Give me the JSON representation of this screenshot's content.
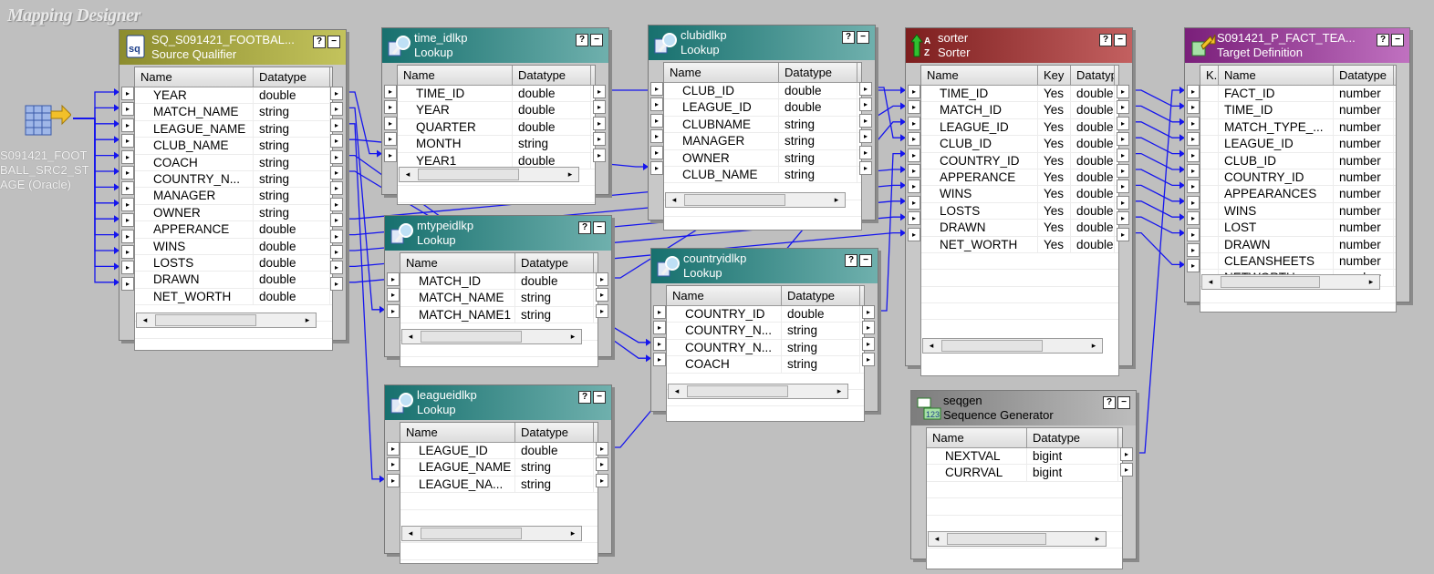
{
  "canvas": {
    "title": "Mapping Designer"
  },
  "source": {
    "label": "S091421_FOOTBALL_SRC2_STAGE (Oracle)",
    "label_lines": [
      "S091421_FOOT",
      "BALL_SRC2_ST",
      "AGE (Oracle)"
    ]
  },
  "colors": {
    "link": "#1515ee",
    "source_qualifier": "#a6a646",
    "lookup": "#3a8f8c",
    "sorter": "#a03a3a",
    "target": "#9c469c",
    "sequence": "#9e9e9e"
  },
  "transforms": {
    "sq": {
      "name": "SQ_S091421_FOOTBAL...",
      "type": "Source Qualifier",
      "icon": "sq-icon",
      "columns": [
        "Name",
        "Datatype"
      ],
      "rows": [
        {
          "name": "YEAR",
          "datatype": "double"
        },
        {
          "name": "MATCH_NAME",
          "datatype": "string"
        },
        {
          "name": "LEAGUE_NAME",
          "datatype": "string"
        },
        {
          "name": "CLUB_NAME",
          "datatype": "string"
        },
        {
          "name": "COACH",
          "datatype": "string"
        },
        {
          "name": "COUNTRY_N...",
          "datatype": "string"
        },
        {
          "name": "MANAGER",
          "datatype": "string"
        },
        {
          "name": "OWNER",
          "datatype": "string"
        },
        {
          "name": "APPERANCE",
          "datatype": "double"
        },
        {
          "name": "WINS",
          "datatype": "double"
        },
        {
          "name": "LOSTS",
          "datatype": "double"
        },
        {
          "name": "DRAWN",
          "datatype": "double"
        },
        {
          "name": "NET_WORTH",
          "datatype": "double"
        }
      ]
    },
    "time": {
      "name": "time_idlkp",
      "type": "Lookup",
      "icon": "lookup-icon",
      "columns": [
        "Name",
        "Datatype"
      ],
      "rows": [
        {
          "name": "TIME_ID",
          "datatype": "double"
        },
        {
          "name": "YEAR",
          "datatype": "double"
        },
        {
          "name": "QUARTER",
          "datatype": "double"
        },
        {
          "name": "MONTH",
          "datatype": "string"
        },
        {
          "name": "YEAR1",
          "datatype": "double"
        }
      ]
    },
    "mtype": {
      "name": "mtypeidlkp",
      "type": "Lookup",
      "icon": "lookup-icon",
      "columns": [
        "Name",
        "Datatype"
      ],
      "rows": [
        {
          "name": "MATCH_ID",
          "datatype": "double"
        },
        {
          "name": "MATCH_NAME",
          "datatype": "string"
        },
        {
          "name": "MATCH_NAME1",
          "datatype": "string"
        }
      ]
    },
    "league": {
      "name": "leagueidlkp",
      "type": "Lookup",
      "icon": "lookup-icon",
      "columns": [
        "Name",
        "Datatype"
      ],
      "rows": [
        {
          "name": "LEAGUE_ID",
          "datatype": "double"
        },
        {
          "name": "LEAGUE_NAME",
          "datatype": "string"
        },
        {
          "name": "LEAGUE_NA...",
          "datatype": "string"
        }
      ]
    },
    "club": {
      "name": "clubidlkp",
      "type": "Lookup",
      "icon": "lookup-icon",
      "columns": [
        "Name",
        "Datatype"
      ],
      "rows": [
        {
          "name": "CLUB_ID",
          "datatype": "double"
        },
        {
          "name": "LEAGUE_ID",
          "datatype": "double"
        },
        {
          "name": "CLUBNAME",
          "datatype": "string"
        },
        {
          "name": "MANAGER",
          "datatype": "string"
        },
        {
          "name": "OWNER",
          "datatype": "string"
        },
        {
          "name": "CLUB_NAME",
          "datatype": "string"
        }
      ]
    },
    "country": {
      "name": "countryidlkp",
      "type": "Lookup",
      "icon": "lookup-icon",
      "columns": [
        "Name",
        "Datatype"
      ],
      "rows": [
        {
          "name": "COUNTRY_ID",
          "datatype": "double"
        },
        {
          "name": "COUNTRY_N...",
          "datatype": "string"
        },
        {
          "name": "COUNTRY_N...",
          "datatype": "string"
        },
        {
          "name": "COACH",
          "datatype": "string"
        }
      ]
    },
    "sorter": {
      "name": "sorter",
      "type": "Sorter",
      "icon": "sorter-icon",
      "columns": [
        "Name",
        "Key",
        "Datatype"
      ],
      "rows": [
        {
          "name": "TIME_ID",
          "key": "Yes",
          "datatype": "double"
        },
        {
          "name": "MATCH_ID",
          "key": "Yes",
          "datatype": "double"
        },
        {
          "name": "LEAGUE_ID",
          "key": "Yes",
          "datatype": "double"
        },
        {
          "name": "CLUB_ID",
          "key": "Yes",
          "datatype": "double"
        },
        {
          "name": "COUNTRY_ID",
          "key": "Yes",
          "datatype": "double"
        },
        {
          "name": "APPERANCE",
          "key": "Yes",
          "datatype": "double"
        },
        {
          "name": "WINS",
          "key": "Yes",
          "datatype": "double"
        },
        {
          "name": "LOSTS",
          "key": "Yes",
          "datatype": "double"
        },
        {
          "name": "DRAWN",
          "key": "Yes",
          "datatype": "double"
        },
        {
          "name": "NET_WORTH",
          "key": "Yes",
          "datatype": "double"
        }
      ]
    },
    "target": {
      "name": "S091421_P_FACT_TEA...",
      "type": "Target Definition",
      "icon": "target-icon",
      "columns": [
        "K.",
        "Name",
        "Datatype"
      ],
      "rows": [
        {
          "name": "FACT_ID",
          "datatype": "number"
        },
        {
          "name": "TIME_ID",
          "datatype": "number"
        },
        {
          "name": "MATCH_TYPE_...",
          "datatype": "number"
        },
        {
          "name": "LEAGUE_ID",
          "datatype": "number"
        },
        {
          "name": "CLUB_ID",
          "datatype": "number"
        },
        {
          "name": "COUNTRY_ID",
          "datatype": "number"
        },
        {
          "name": "APPEARANCES",
          "datatype": "number"
        },
        {
          "name": "WINS",
          "datatype": "number"
        },
        {
          "name": "LOST",
          "datatype": "number"
        },
        {
          "name": "DRAWN",
          "datatype": "number"
        },
        {
          "name": "CLEANSHEETS",
          "datatype": "number"
        },
        {
          "name": "NETWORTH",
          "datatype": "number"
        }
      ]
    },
    "seq": {
      "name": "seqgen",
      "type": "Sequence Generator",
      "icon": "sequence-icon",
      "columns": [
        "Name",
        "Datatype"
      ],
      "rows": [
        {
          "name": "NEXTVAL",
          "datatype": "bigint"
        },
        {
          "name": "CURRVAL",
          "datatype": "bigint"
        }
      ]
    }
  }
}
